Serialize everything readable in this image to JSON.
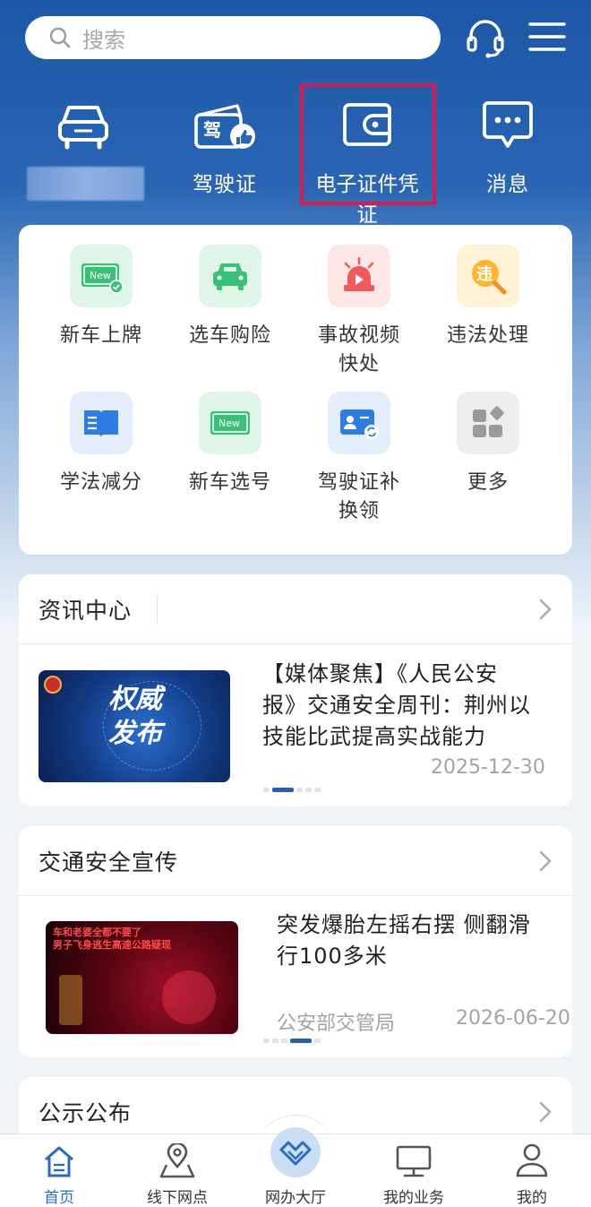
{
  "search": {
    "placeholder": "搜索"
  },
  "quick_actions": [
    {
      "label": "",
      "icon": "car-icon"
    },
    {
      "label": "驾驶证",
      "icon": "driver-license-icon",
      "badge": "驾"
    },
    {
      "label": "电子证件凭证",
      "icon": "wallet-icon"
    },
    {
      "label": "消息",
      "icon": "message-icon"
    }
  ],
  "services": [
    {
      "label": "新车上牌",
      "icon": "new-plate-icon",
      "color": "#dff5e8",
      "badge": "New"
    },
    {
      "label": "选车购险",
      "icon": "car-insurance-icon",
      "color": "#dff5e8"
    },
    {
      "label": "事故视频快处",
      "line1": "事故视频",
      "line2": "快处",
      "icon": "alarm-icon",
      "color": "#fde6e6"
    },
    {
      "label": "违法处理",
      "icon": "violation-icon",
      "color": "#fff2d6",
      "badge": "违"
    },
    {
      "label": "学法减分",
      "icon": "book-icon",
      "color": "#e3edfb"
    },
    {
      "label": "新车选号",
      "icon": "plate-select-icon",
      "color": "#dff5e8",
      "badge": "New"
    },
    {
      "label": "驾驶证补换领",
      "line1": "驾驶证补",
      "line2": "换领",
      "icon": "license-renew-icon",
      "color": "#e3edfb"
    },
    {
      "label": "更多",
      "icon": "more-grid-icon",
      "color": "#ededed"
    }
  ],
  "news": {
    "title": "资讯中心",
    "image_text_line1": "权威",
    "image_text_line2": "发布",
    "headline_line1": "【媒体聚焦】《人民公安",
    "headline_line2": "报》交通安全周刊：荆州以",
    "headline_line3": "技能比武提高实战能力",
    "date": "2025-12-30"
  },
  "safety": {
    "title": "交通安全宣传",
    "image_caption_line1": "车和老婆全都不要了",
    "image_caption_line2": "男子飞身逃生高速公路疑现",
    "headline_line1": "突发爆胎左摇右摆 侧翻滑",
    "headline_line2": "行100多米",
    "source": "公安部交管局",
    "date": "2026-06-20"
  },
  "notice": {
    "title": "公示公布"
  },
  "tabbar": [
    {
      "label": "首页",
      "icon": "home-icon",
      "active": true
    },
    {
      "label": "线下网点",
      "icon": "location-icon"
    },
    {
      "label": "网办大厅",
      "icon": "online-hall-icon"
    },
    {
      "label": "我的业务",
      "icon": "monitor-icon"
    },
    {
      "label": "我的",
      "icon": "user-icon"
    }
  ],
  "colors": {
    "brand_blue": "#1d57a6",
    "highlight": "#d81b55",
    "active_tab": "#2a6bc0"
  }
}
